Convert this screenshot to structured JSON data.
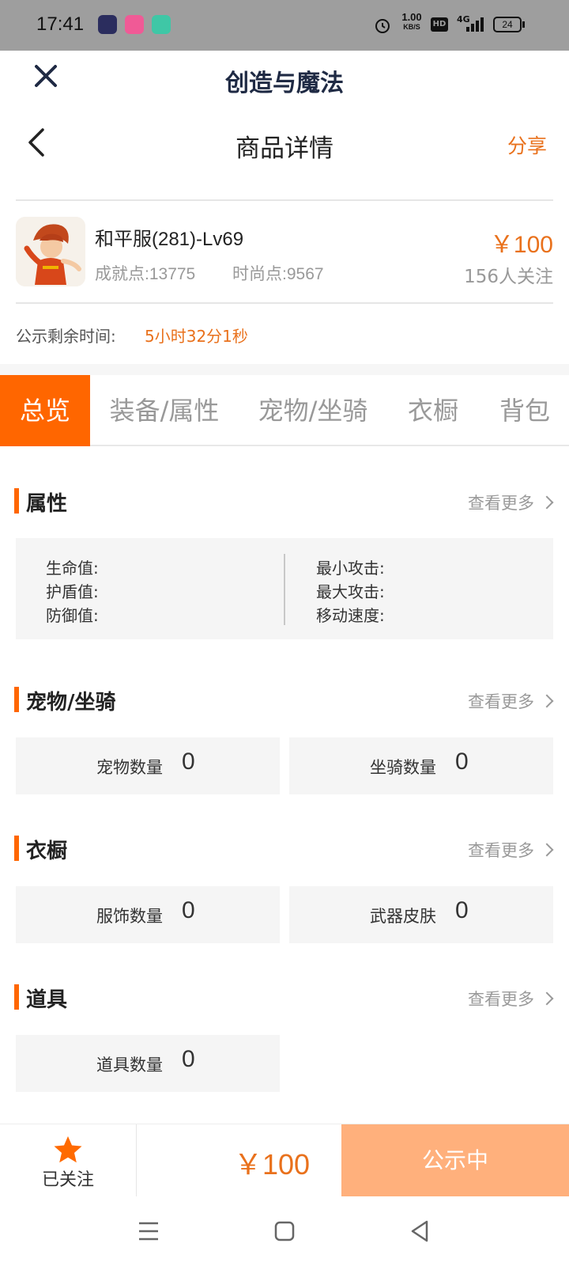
{
  "status_bar": {
    "time": "17:41",
    "net_speed_value": "1.00",
    "net_speed_unit": "KB/S",
    "hd": "HD",
    "network": "4G",
    "battery": "24"
  },
  "title_bar": {
    "app_title": "创造与魔法"
  },
  "page_header": {
    "title": "商品详情",
    "share_label": "分享"
  },
  "product": {
    "name": "和平服(281)-Lv69",
    "achievement": "成就点:13775",
    "fashion": "时尚点:9567",
    "price": "￥100",
    "followers": "156人关注"
  },
  "countdown": {
    "label": "公示剩余时间:",
    "value": "5小时32分1秒"
  },
  "tabs": [
    {
      "label": "总览",
      "active": true
    },
    {
      "label": "装备/属性",
      "active": false
    },
    {
      "label": "宠物/坐骑",
      "active": false
    },
    {
      "label": "衣橱",
      "active": false
    },
    {
      "label": "背包",
      "active": false
    }
  ],
  "sections": {
    "more_label": "查看更多",
    "attributes": {
      "title": "属性",
      "left": [
        "生命值:",
        "护盾值:",
        "防御值:"
      ],
      "right": [
        "最小攻击:",
        "最大攻击:",
        "移动速度:"
      ]
    },
    "pets": {
      "title": "宠物/坐骑",
      "items": [
        {
          "label": "宠物数量",
          "value": "0"
        },
        {
          "label": "坐骑数量",
          "value": "0"
        }
      ]
    },
    "wardrobe": {
      "title": "衣橱",
      "items": [
        {
          "label": "服饰数量",
          "value": "0"
        },
        {
          "label": "武器皮肤",
          "value": "0"
        }
      ]
    },
    "props": {
      "title": "道具",
      "items": [
        {
          "label": "道具数量",
          "value": "0"
        }
      ]
    }
  },
  "bottom_bar": {
    "follow_label": "已关注",
    "price": "￥100",
    "status_label": "公示中"
  },
  "colors": {
    "accent": "#ff6600",
    "price": "#e9711c",
    "status_button": "#ffb07c"
  }
}
